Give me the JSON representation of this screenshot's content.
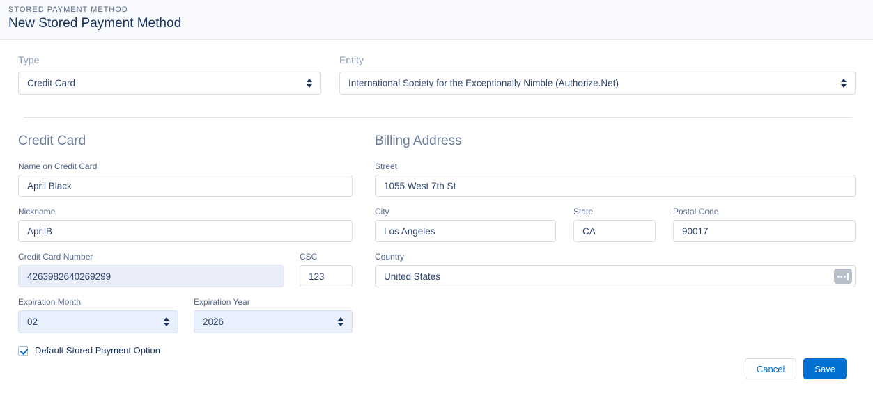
{
  "header": {
    "eyebrow": "Stored Payment Method",
    "title": "New Stored Payment Method"
  },
  "top_fields": {
    "type": {
      "label": "Type",
      "value": "Credit Card"
    },
    "entity": {
      "label": "Entity",
      "value": "International Society for the Exceptionally Nimble (Authorize.Net)"
    }
  },
  "credit_card": {
    "section_title": "Credit Card",
    "name": {
      "label": "Name on Credit Card",
      "value": "April Black"
    },
    "nickname": {
      "label": "Nickname",
      "value": "AprilB"
    },
    "number": {
      "label": "Credit Card Number",
      "value": "4263982640269299"
    },
    "csc": {
      "label": "CSC",
      "value": "123"
    },
    "exp_month": {
      "label": "Expiration Month",
      "value": "02"
    },
    "exp_year": {
      "label": "Expiration Year",
      "value": "2026"
    },
    "default_option": {
      "label": "Default Stored Payment Option",
      "checked": true
    }
  },
  "billing": {
    "section_title": "Billing Address",
    "street": {
      "label": "Street",
      "value": "1055 West 7th St"
    },
    "city": {
      "label": "City",
      "value": "Los Angeles"
    },
    "state": {
      "label": "State",
      "value": "CA"
    },
    "postal": {
      "label": "Postal Code",
      "value": "90017"
    },
    "country": {
      "label": "Country",
      "value": "United States"
    }
  },
  "footer": {
    "cancel_label": "Cancel",
    "save_label": "Save"
  },
  "colors": {
    "accent_blue": "#0070d2",
    "title_navy": "#16325c",
    "label_gray_blue": "#54698d",
    "autofill_blue_bg": "#e8f0fe",
    "card_number_bg": "#e9edf9",
    "header_bg": "#f7f9fc",
    "input_border": "#d8dde6"
  }
}
